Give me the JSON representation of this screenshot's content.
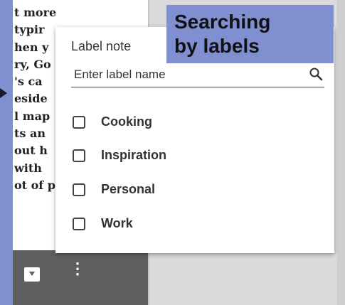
{
  "note": {
    "text_lines": [
      "t more",
      "typir",
      "hen y",
      "ry, Go",
      "'s ca",
      "eside",
      "l map",
      "ts an",
      "out h",
      " with",
      "ot of p"
    ]
  },
  "toolbar": {
    "icons": [
      "archive-icon",
      "more-vert-icon"
    ],
    "more_glyph": "⋮"
  },
  "popup": {
    "title": "Label note",
    "search": {
      "placeholder": "Enter label name",
      "value": ""
    },
    "labels": [
      {
        "name": "Cooking",
        "checked": false
      },
      {
        "name": "Inspiration",
        "checked": false
      },
      {
        "name": "Personal",
        "checked": false
      },
      {
        "name": "Work",
        "checked": false
      }
    ]
  },
  "caption": {
    "line1": "Searching",
    "line2": "by labels"
  },
  "colors": {
    "background": "#7f8fcf",
    "toolbar": "#5f5f5f",
    "popup": "#ffffff"
  }
}
